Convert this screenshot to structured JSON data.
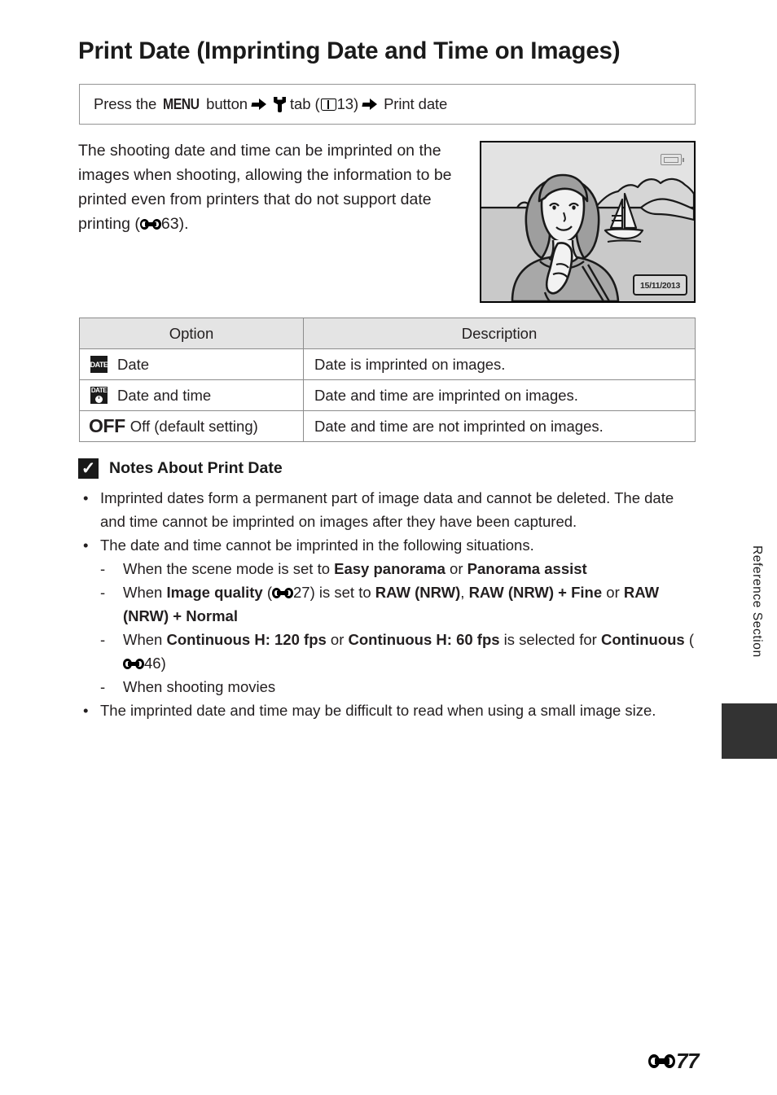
{
  "page": {
    "title": "Print Date (Imprinting Date and Time on Images)",
    "number": "77",
    "section_icon": "reference-section-icon",
    "side_tab_label": "Reference Section"
  },
  "menu_path": {
    "prefix": "Press the",
    "menu_button": "MENU",
    "button_word": "button",
    "arrow1": "➜",
    "setup_tab_icon": "wrench-icon",
    "tab_word": "tab",
    "open_paren": "(",
    "book_icon": "book-icon",
    "page_ref": "13",
    "close_paren": ")",
    "arrow2": "➜",
    "destination": "Print date"
  },
  "intro": {
    "line1": "The shooting date and time can be imprinted on",
    "line2": "the images when shooting, allowing the",
    "line3": "information to be printed even from printers that",
    "line4_pre": "do not support date printing (",
    "line4_ref": "63",
    "line4_post": ")."
  },
  "illustration": {
    "name": "camera-monitor-preview",
    "date_stamp": "15/11/2013",
    "battery_icon": "battery-icon",
    "colors": {
      "sky": "#e3e3e3",
      "sea": "#c9c9c9",
      "hill": "#d6d6d6",
      "hair": "#9e9e9e",
      "clothing": "#a8a8a8",
      "skin": "#f2f2f2",
      "outline": "#1a1a1a"
    }
  },
  "table": {
    "headers": [
      "Option",
      "Description"
    ],
    "rows": [
      {
        "icon": "date-icon",
        "icon_text": "DATE",
        "option": "Date",
        "description": "Date is imprinted on images."
      },
      {
        "icon": "date-time-icon",
        "icon_text": "DATE",
        "option": "Date and time",
        "description": "Date and time are imprinted on images."
      },
      {
        "icon": "off-icon",
        "icon_text": "OFF",
        "option": "Off (default setting)",
        "description": "Date and time are not imprinted on images."
      }
    ]
  },
  "notes": {
    "mark": "caution-icon",
    "title": "Notes About Print Date",
    "bullets": [
      "Imprinted dates form a permanent part of image data and cannot be deleted. The date and time cannot be imprinted on images after they have been captured.",
      "The date and time cannot be imprinted in the following situations.",
      "The imprinted date and time may be difficult to read when using a small image size."
    ],
    "sub_bullets": [
      {
        "text_parts": [
          "When the scene mode is set to ",
          "Easy panorama",
          " or ",
          "Panorama assist"
        ]
      },
      {
        "text_parts": [
          "When ",
          "Image quality",
          " (",
          "27",
          ") is set to ",
          "RAW (NRW)",
          ", ",
          "RAW (NRW) + Fine",
          " or ",
          "RAW (NRW) + Normal"
        ]
      },
      {
        "text_parts": [
          "When ",
          "Continuous H: 120 fps",
          " or ",
          "Continuous H: 60 fps",
          " is selected for ",
          "Continuous",
          " (",
          "46",
          ")"
        ]
      },
      {
        "text_parts": [
          "When shooting movies"
        ]
      }
    ]
  },
  "colors": {
    "text": "#231f20",
    "table_header_bg": "#e4e4e4",
    "border": "#8c8c8c",
    "side_tab": "#333333"
  }
}
